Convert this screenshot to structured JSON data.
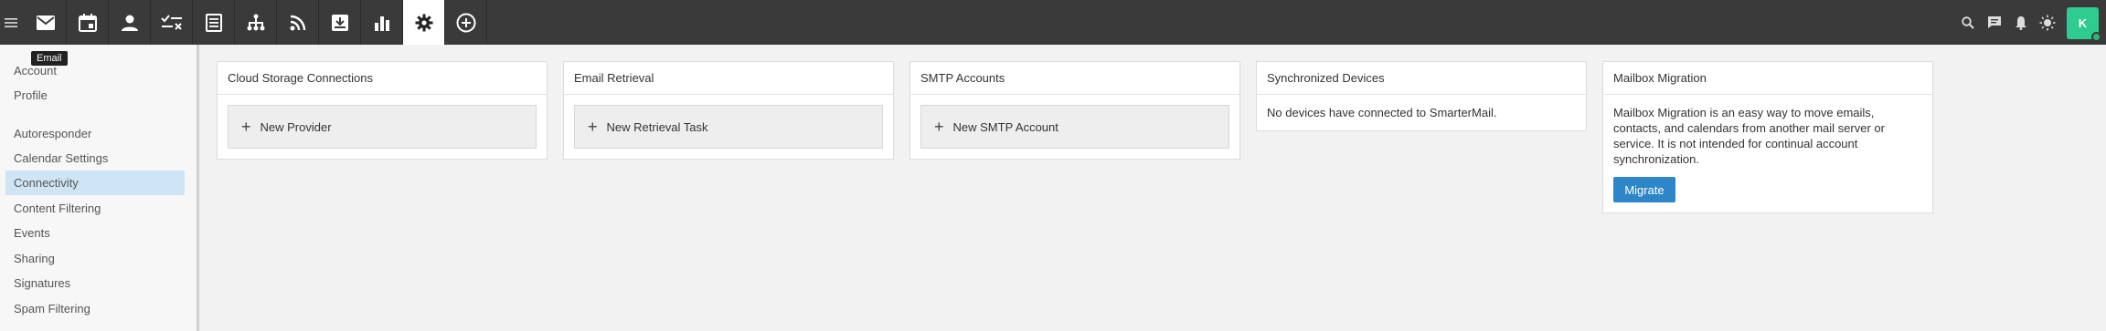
{
  "topbar": {
    "menu_icon": "hamburger-icon",
    "nav": [
      {
        "icon": "mail-icon",
        "active": false
      },
      {
        "icon": "calendar-icon",
        "active": false
      },
      {
        "icon": "contacts-icon",
        "active": false
      },
      {
        "icon": "tasks-icon",
        "active": false
      },
      {
        "icon": "notes-icon",
        "active": false
      },
      {
        "icon": "file-tree-icon",
        "active": false
      },
      {
        "icon": "rss-icon",
        "active": false
      },
      {
        "icon": "inbox-download-icon",
        "active": false
      },
      {
        "icon": "bar-chart-icon",
        "active": false
      },
      {
        "icon": "gear-icon",
        "active": true
      },
      {
        "icon": "add-circle-icon",
        "active": false
      }
    ],
    "right_icons": [
      "search-icon",
      "chat-icon",
      "bell-icon",
      "brightness-icon"
    ],
    "avatar_initial": "K",
    "avatar_color": "#2ecc8f"
  },
  "tooltip": "Email",
  "sidebar": {
    "items": [
      {
        "label": "Account"
      },
      {
        "label": "Profile"
      },
      {
        "label": "Autoresponder"
      },
      {
        "label": "Calendar Settings"
      },
      {
        "label": "Connectivity",
        "active": true
      },
      {
        "label": "Content Filtering"
      },
      {
        "label": "Events"
      },
      {
        "label": "Sharing"
      },
      {
        "label": "Signatures"
      },
      {
        "label": "Spam Filtering"
      }
    ]
  },
  "cards": {
    "cloud": {
      "title": "Cloud Storage Connections",
      "button": "New Provider"
    },
    "retrieval": {
      "title": "Email Retrieval",
      "button": "New Retrieval Task"
    },
    "smtp": {
      "title": "SMTP Accounts",
      "button": "New SMTP Account"
    },
    "devices": {
      "title": "Synchronized Devices",
      "text": "No devices have connected to SmarterMail."
    },
    "migration": {
      "title": "Mailbox Migration",
      "text": "Mailbox Migration is an easy way to move emails, contacts, and calendars from another mail server or service. It is not intended for continual account synchronization.",
      "button": "Migrate"
    }
  },
  "colors": {
    "accent": "#2d86c8",
    "active_side": "#cfe4f5",
    "topbar": "#3a3a3a"
  }
}
